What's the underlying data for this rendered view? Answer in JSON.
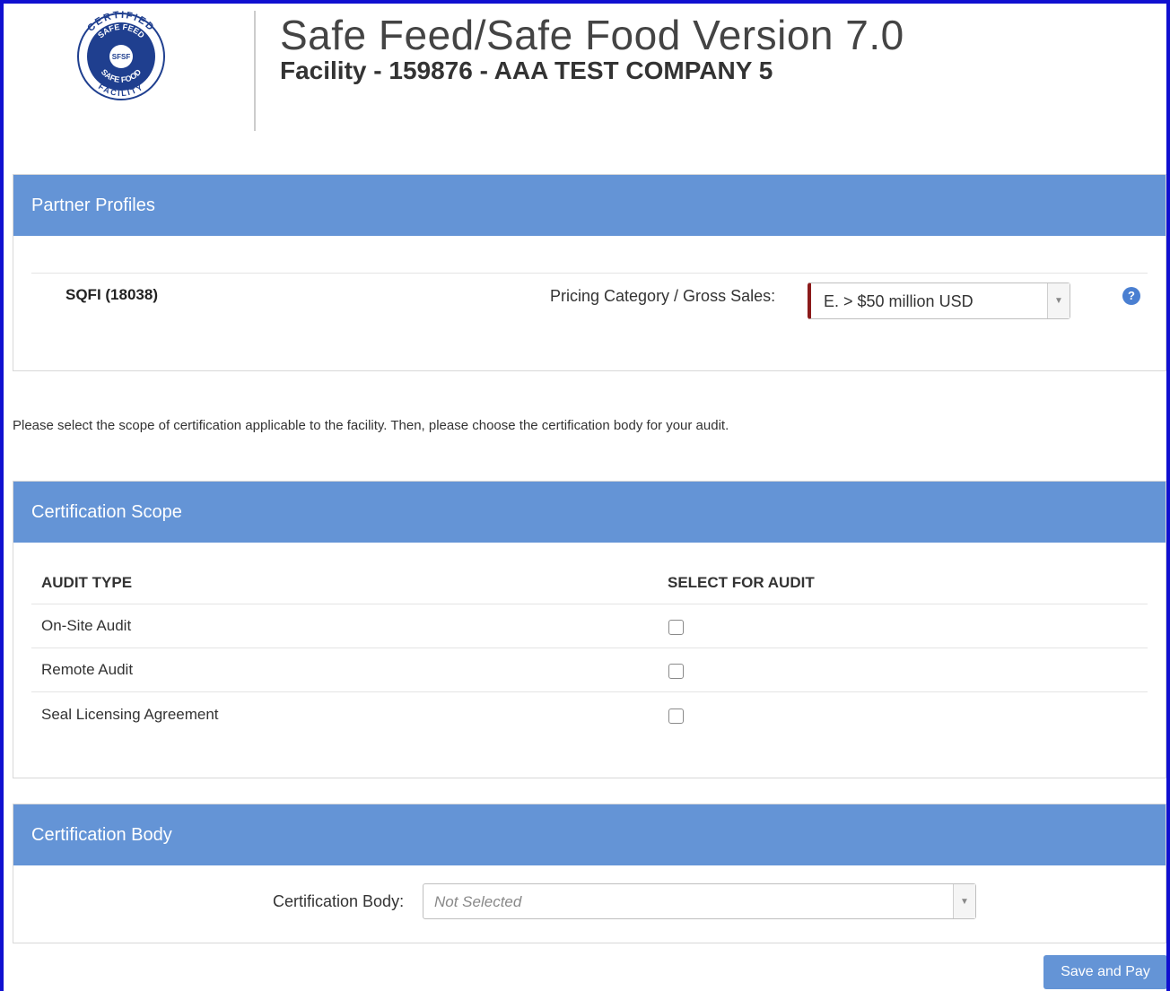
{
  "header": {
    "title": "Safe Feed/Safe Food Version 7.0",
    "subtitle": "Facility - 159876 - AAA TEST COMPANY 5",
    "logo": {
      "top_text": "CERTIFIED",
      "ring_top": "SAFE FEED",
      "center": "SFSF",
      "ring_bottom": "SAFE FOOD",
      "bottom_text": "FACILITY"
    }
  },
  "partners": {
    "heading": "Partner Profiles",
    "partner_name": "SQFI (18038)",
    "pricing_label": "Pricing Category / Gross Sales:",
    "pricing_value": "E. > $50 million USD",
    "help_glyph": "?"
  },
  "instructions": "Please select the scope of certification applicable to the facility. Then, please choose the certification body for your audit.",
  "scope": {
    "heading": "Certification Scope",
    "col_audit_type": "AUDIT TYPE",
    "col_select": "SELECT FOR AUDIT",
    "rows": [
      {
        "label": "On-Site Audit",
        "checked": false
      },
      {
        "label": "Remote Audit",
        "checked": false
      },
      {
        "label": "Seal Licensing Agreement",
        "checked": false
      }
    ]
  },
  "cert_body": {
    "heading": "Certification Body",
    "label": "Certification Body:",
    "value": "Not Selected"
  },
  "actions": {
    "save_pay": "Save and Pay"
  },
  "colors": {
    "panel_header": "#6494d6",
    "accent_required": "#8b1a1a",
    "logo_blue": "#1f3f8f"
  }
}
